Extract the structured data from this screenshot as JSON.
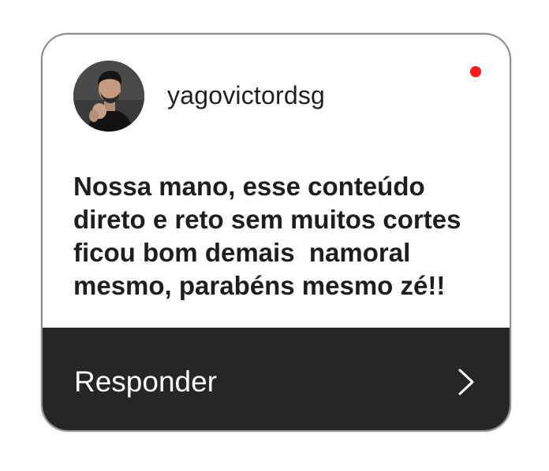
{
  "notification": {
    "username": "yagovictordsg",
    "avatar_icon": "user-avatar",
    "unread_indicator_color": "#ff1a1a",
    "message": "Nossa mano, esse conteúdo direto e reto sem muitos cortes ficou bom demais  namoral mesmo, parabéns mesmo zé!!",
    "reply_label": "Responder",
    "reply_icon": "chevron-right-icon"
  }
}
